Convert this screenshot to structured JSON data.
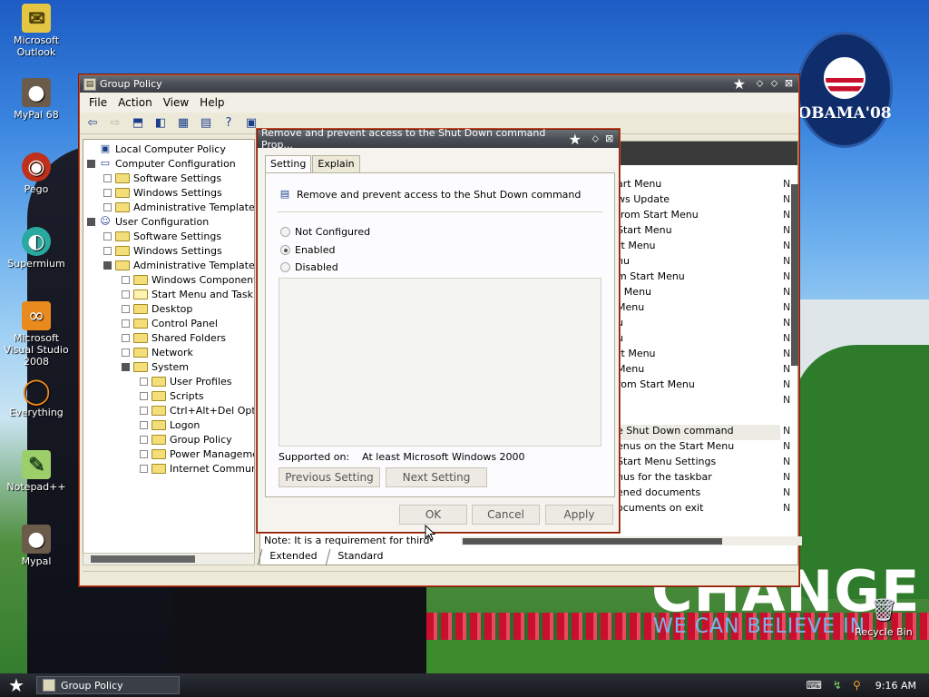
{
  "desktop": {
    "icons": [
      {
        "label": "Microsoft Outlook",
        "icon": "outlook-icon"
      },
      {
        "label": "MyPal 68",
        "icon": "mypal-icon"
      },
      {
        "label": "Pego",
        "icon": "pego-icon"
      },
      {
        "label": "Supermium",
        "icon": "supermium-icon"
      },
      {
        "label": "Microsoft Visual Studio 2008",
        "icon": "visual-studio-icon"
      },
      {
        "label": "Everything",
        "icon": "everything-icon"
      },
      {
        "label": "Notepad++",
        "icon": "notepadpp-icon"
      },
      {
        "label": "Mypal",
        "icon": "mypal-icon"
      }
    ],
    "recycle_bin": "Recycle Bin",
    "wallpaper": {
      "logo_text": "OBAMA'08",
      "slogan": "CHANGE",
      "sub_slogan": "WE CAN BELIEVE IN"
    }
  },
  "main_window": {
    "title": "Group Policy",
    "menu": [
      "File",
      "Action",
      "View",
      "Help"
    ],
    "tree": [
      {
        "label": "Local Computer Policy",
        "level": 0,
        "kind": "policy"
      },
      {
        "label": "Computer Configuration",
        "level": 1,
        "kind": "computer"
      },
      {
        "label": "Software Settings",
        "level": 2,
        "kind": "folder"
      },
      {
        "label": "Windows Settings",
        "level": 2,
        "kind": "folder"
      },
      {
        "label": "Administrative Templates",
        "level": 2,
        "kind": "folder"
      },
      {
        "label": "User Configuration",
        "level": 1,
        "kind": "user"
      },
      {
        "label": "Software Settings",
        "level": 2,
        "kind": "folder"
      },
      {
        "label": "Windows Settings",
        "level": 2,
        "kind": "folder"
      },
      {
        "label": "Administrative Templates",
        "level": 2,
        "kind": "folder"
      },
      {
        "label": "Windows Components",
        "level": 3,
        "kind": "folder"
      },
      {
        "label": "Start Menu and Taskba",
        "level": 3,
        "kind": "folder-open"
      },
      {
        "label": "Desktop",
        "level": 3,
        "kind": "folder"
      },
      {
        "label": "Control Panel",
        "level": 3,
        "kind": "folder"
      },
      {
        "label": "Shared Folders",
        "level": 3,
        "kind": "folder"
      },
      {
        "label": "Network",
        "level": 3,
        "kind": "folder"
      },
      {
        "label": "System",
        "level": 3,
        "kind": "folder"
      },
      {
        "label": "User Profiles",
        "level": 4,
        "kind": "folder"
      },
      {
        "label": "Scripts",
        "level": 4,
        "kind": "folder"
      },
      {
        "label": "Ctrl+Alt+Del Optio",
        "level": 4,
        "kind": "folder"
      },
      {
        "label": "Logon",
        "level": 4,
        "kind": "folder"
      },
      {
        "label": "Group Policy",
        "level": 4,
        "kind": "folder"
      },
      {
        "label": "Power Managemen",
        "level": 4,
        "kind": "folder"
      },
      {
        "label": "Internet Communic",
        "level": 4,
        "kind": "folder"
      }
    ],
    "settings_rows": [
      {
        "text": "art Menu",
        "state": "N"
      },
      {
        "text": "ws Update",
        "state": "N"
      },
      {
        "text": "from Start Menu",
        "state": "N"
      },
      {
        "text": "Start Menu",
        "state": "N"
      },
      {
        "text": "rt Menu",
        "state": "N"
      },
      {
        "text": "nu",
        "state": "N"
      },
      {
        "text": "m Start Menu",
        "state": "N"
      },
      {
        "text": "t Menu",
        "state": "N"
      },
      {
        "text": "Menu",
        "state": "N"
      },
      {
        "text": "u",
        "state": "N"
      },
      {
        "text": "u",
        "state": "N"
      },
      {
        "text": "rt Menu",
        "state": "N"
      },
      {
        "text": "Menu",
        "state": "N"
      },
      {
        "text": "rom Start Menu",
        "state": "N"
      },
      {
        "text": "",
        "state": "N"
      },
      {
        "text": "",
        "state": ""
      },
      {
        "text": "e Shut Down command",
        "state": "N"
      },
      {
        "text": "enus on the Start Menu",
        "state": "N"
      },
      {
        "text": "Start Menu Settings",
        "state": "N"
      },
      {
        "text": "nus for the taskbar",
        "state": "N"
      },
      {
        "text": "ened documents",
        "state": "N"
      },
      {
        "text": "ocuments on exit",
        "state": "N"
      }
    ],
    "note_text": "Note: It is a requirement for third-",
    "bottom_tabs": [
      "Extended",
      "Standard"
    ]
  },
  "dialog": {
    "title": "Remove and prevent access to the Shut Down command Prop...",
    "tabs": [
      "Setting",
      "Explain"
    ],
    "active_tab": "Setting",
    "policy_name": "Remove and prevent access to the Shut Down command",
    "options": [
      "Not Configured",
      "Enabled",
      "Disabled"
    ],
    "selected_option": "Enabled",
    "supported_label": "Supported on:",
    "supported_value": "At least Microsoft Windows 2000",
    "prev_button": "Previous Setting",
    "next_button": "Next Setting",
    "ok_button": "OK",
    "cancel_button": "Cancel",
    "apply_button": "Apply"
  },
  "taskbar": {
    "task_label": "Group Policy",
    "clock": "9:16 AM"
  },
  "colors": {
    "window_border": "#c54a28",
    "titlebar": "#4a4f55",
    "face": "#ece9d8"
  }
}
